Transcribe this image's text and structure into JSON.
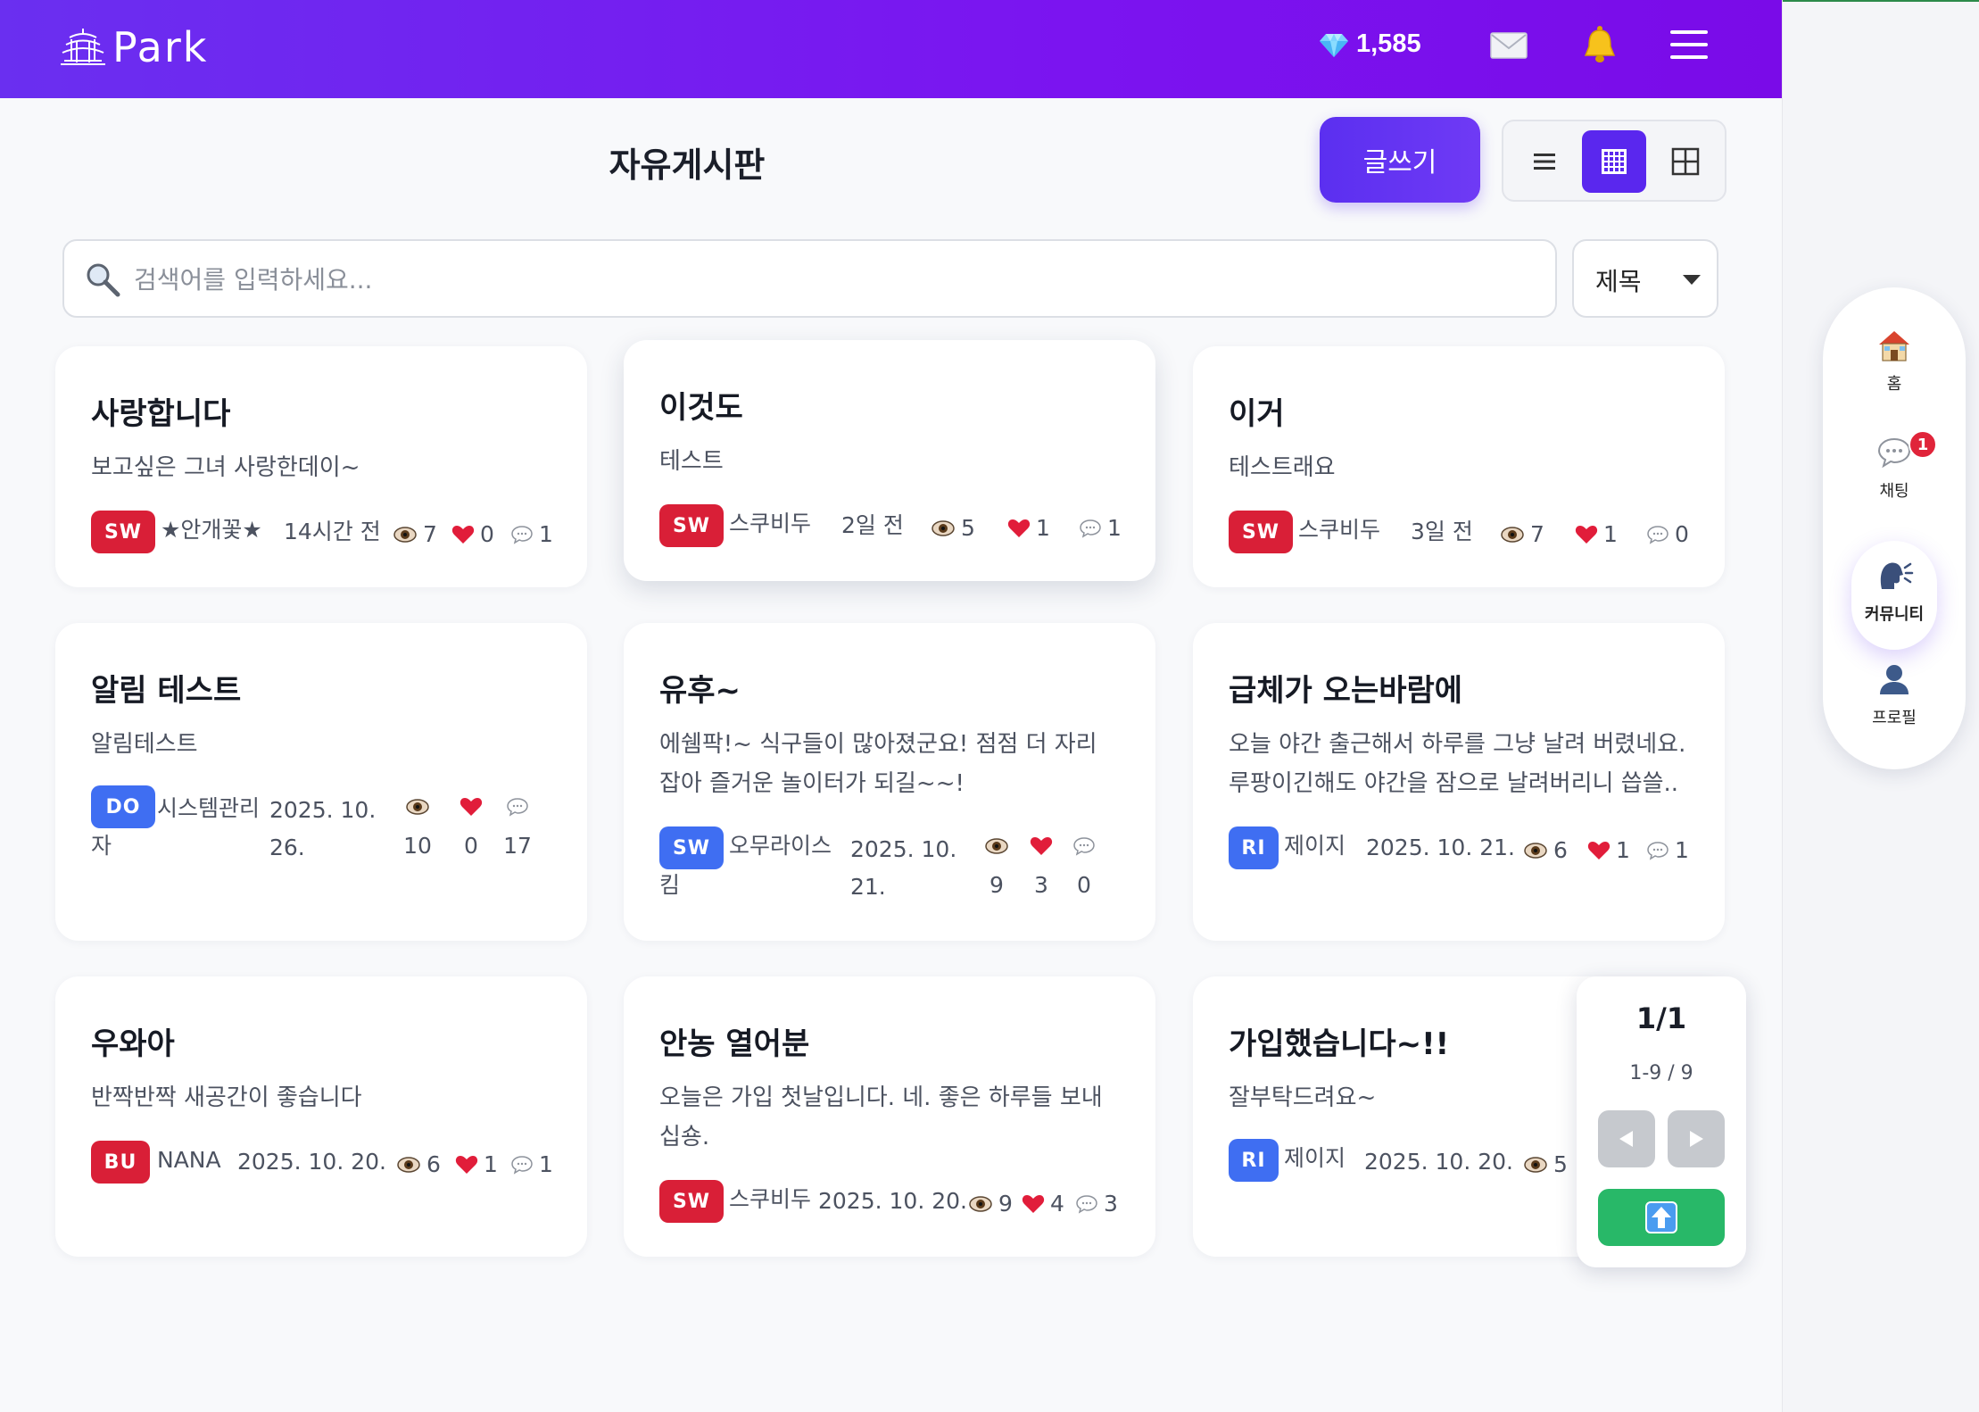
{
  "header": {
    "logo_text": "Park",
    "gem_count": "1,585"
  },
  "board": {
    "title": "자유게시판",
    "write_label": "글쓰기"
  },
  "search": {
    "placeholder": "검색어를 입력하세요...",
    "filter_value": "제목"
  },
  "posts": [
    {
      "title": "사랑합니다",
      "body": "보고싶은 그녀 사랑한데이~",
      "badge": "SW",
      "badge_color": "#d91f37",
      "author": "★안개꽃★",
      "time": "14시간 전",
      "views": "7",
      "likes": "0",
      "comments": "1"
    },
    {
      "title": "이것도",
      "body": "테스트",
      "badge": "SW",
      "badge_color": "#d91f37",
      "author": "스쿠비두",
      "time": "2일 전",
      "views": "5",
      "likes": "1",
      "comments": "1"
    },
    {
      "title": "이거",
      "body": "테스트래요",
      "badge": "SW",
      "badge_color": "#d91f37",
      "author": "스쿠비두",
      "time": "3일 전",
      "views": "7",
      "likes": "1",
      "comments": "0"
    },
    {
      "title": "알림 테스트",
      "body": "알림테스트",
      "badge": "DO",
      "badge_color": "#3f6ef2",
      "author_line1": "시스템관리",
      "author_line2": "자",
      "time_line1": "2025. 10.",
      "time_line2": "26.",
      "views": "10",
      "likes": "0",
      "comments": "17"
    },
    {
      "title": "유후~",
      "body_line1": "에쉠팍!~ 식구들이 많아졌군요! 점점 더 자리",
      "body_line2": "잡아 즐거운 놀이터가 되길~~!",
      "badge": "SW",
      "badge_color": "#3f6ef2",
      "author_line1": "오무라이스",
      "author_line2": "킴",
      "time_line1": "2025. 10.",
      "time_line2": "21.",
      "views": "9",
      "likes": "3",
      "comments": "0"
    },
    {
      "title": "급체가 오는바람에",
      "body_line1": "오늘 야간 출근해서 하루를 그냥 날려 버렸네요.",
      "body_line2": "루팡이긴해도 야간을 잠으로 날려버리니 씁쓸..",
      "badge": "RI",
      "badge_color": "#3f6ef2",
      "author": "제이지",
      "time": "2025. 10. 21.",
      "views": "6",
      "likes": "1",
      "comments": "1"
    },
    {
      "title": "우와아",
      "body": "반짝반짝 새공간이 좋습니다",
      "badge": "BU",
      "badge_color": "#d91f37",
      "author": "NANA",
      "time": "2025. 10. 20.",
      "views": "6",
      "likes": "1",
      "comments": "1"
    },
    {
      "title": "안농 열어분",
      "body_line1": "오늘은 가입 첫날입니다. 네. 좋은 하루들 보내",
      "body_line2": "십숑.",
      "badge": "SW",
      "badge_color": "#d91f37",
      "author": "스쿠비두",
      "time": "2025. 10. 20.",
      "views": "9",
      "likes": "4",
      "comments": "3"
    },
    {
      "title": "가입했습니다~!!",
      "body": "잘부탁드려요~",
      "badge": "RI",
      "badge_color": "#3f6ef2",
      "author": "제이지",
      "time": "2025. 10. 20.",
      "views": "5"
    }
  ],
  "right_nav": {
    "home": "홈",
    "chat": "채팅",
    "chat_badge": "1",
    "community": "커뮤니티",
    "profile": "프로필"
  },
  "pager": {
    "page": "1/1",
    "range": "1-9 / 9"
  },
  "colors": {
    "header_gradient_start": "#6a2ff0",
    "header_gradient_end": "#7a0be8",
    "accent": "#5a27ee",
    "badge_red": "#d91f37",
    "badge_blue": "#3f6ef2",
    "scroll_top_green": "#28b868"
  },
  "icons": {
    "logo": "temple-logo-icon",
    "gem": "diamond-icon",
    "mail": "envelope-icon",
    "bell": "bell-icon",
    "menu": "hamburger-icon",
    "search": "magnifier-icon",
    "view": "eye-icon",
    "like": "heart-icon",
    "comment": "speech-bubble-icon",
    "home": "house-icon",
    "community": "speaking-head-icon",
    "profile": "person-icon"
  }
}
